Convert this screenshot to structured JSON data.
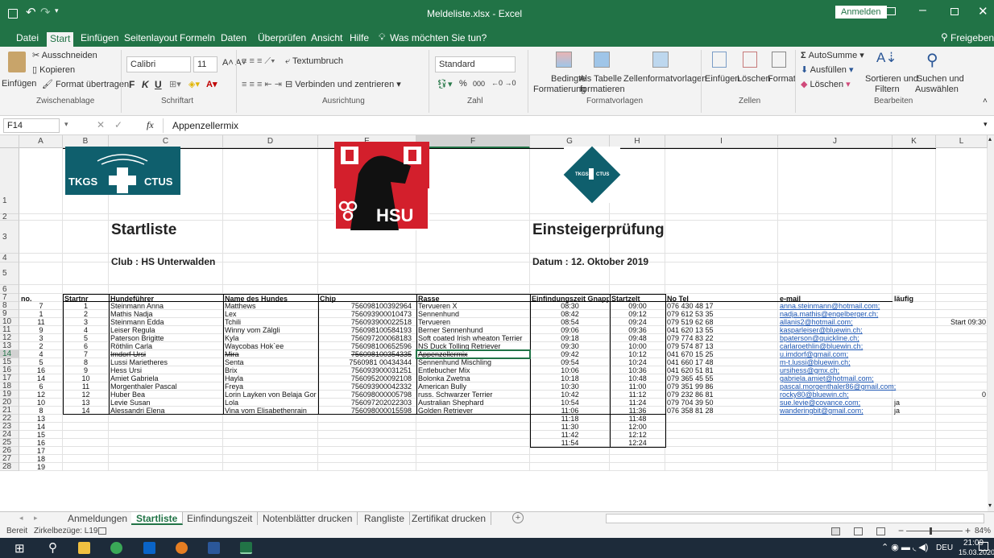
{
  "window": {
    "title": "Meldeliste.xlsx  -  Excel",
    "signin": "Anmelden"
  },
  "tabs": [
    "Datei",
    "Start",
    "Einfügen",
    "Seitenlayout",
    "Formeln",
    "Daten",
    "Überprüfen",
    "Ansicht",
    "Hilfe"
  ],
  "tell_me": "Was möchten Sie tun?",
  "share": "Freigeben",
  "ribbon": {
    "paste": "Einfügen",
    "cut": "Ausschneiden",
    "copy": "Kopieren",
    "format_painter": "Format übertragen",
    "clipboard_group": "Zwischenablage",
    "font_name": "Calibri",
    "font_size": "11",
    "bold": "F",
    "italic": "K",
    "underline": "U",
    "font_group": "Schriftart",
    "wrap": "Textumbruch",
    "merge": "Verbinden und zentrieren",
    "align_group": "Ausrichtung",
    "number_format": "Standard",
    "percent": "%",
    "thousands": "000",
    "number_group": "Zahl",
    "cond_format_1": "Bedingte",
    "cond_format_2": "Formatierung",
    "as_table_1": "Als Tabelle",
    "as_table_2": "formatieren",
    "cell_styles": "Zellenformatvorlagen",
    "styles_group": "Formatvorlagen",
    "insert": "Einfügen",
    "delete": "Löschen",
    "format": "Format",
    "cells_group": "Zellen",
    "autosum": "AutoSumme",
    "fill": "Ausfüllen",
    "clear": "Löschen",
    "sort_1": "Sortieren und",
    "sort_2": "Filtern",
    "find_1": "Suchen und",
    "find_2": "Auswählen",
    "edit_group": "Bearbeiten"
  },
  "formula_bar": {
    "name_box": "F14",
    "fx": "fx",
    "formula": "Appenzellermix"
  },
  "columns": [
    "A",
    "B",
    "C",
    "D",
    "E",
    "F",
    "G",
    "H",
    "I",
    "J",
    "K",
    "L"
  ],
  "sheet": {
    "logo_left": [
      "TKGS",
      "CTUS"
    ],
    "logo_mid": "HSU",
    "logo_right": [
      "TKGS",
      "CTUS"
    ],
    "title_left": "Startliste",
    "title_right": "Einsteigerprüfung",
    "club": "Club :  HS Unterwalden",
    "date": "Datum : 12. Oktober 2019",
    "headers": [
      "no.",
      "Startnr",
      "Hundeführer",
      "Name des Hundes",
      "Chip",
      "Rasse",
      "Einfindungszeit Gnappi",
      "Startzelt",
      "No Tel",
      "e-mail",
      "läufig",
      ""
    ],
    "rows": [
      [
        "7",
        "1",
        "Steinmann Anna",
        "Matthews",
        "756098100392964",
        "Tervueren X",
        "08:30",
        "09:00",
        "076 430 48 17",
        "anna.steinmann@hotmail.com;",
        "",
        ""
      ],
      [
        "1",
        "2",
        "Mathis Nadja",
        "Lex",
        "756093900010473",
        "Sennenhund",
        "08:42",
        "09:12",
        "079 612 53 35",
        "nadja.mathis@engelberger.ch;",
        "",
        ""
      ],
      [
        "11",
        "3",
        "Steinmann Edda",
        "Tchili",
        "756093900022518",
        "Tervueren",
        "08:54",
        "09:24",
        "079 519 62 68",
        "allanis2@hotmail.com;",
        "",
        "Start 09:30"
      ],
      [
        "9",
        "4",
        "Leiser Regula",
        "Winny vom Zälgli",
        "756098100584193",
        "Berner Sennenhund",
        "09:06",
        "09:36",
        "041 620 13 55",
        "kasparleiser@bluewin.ch;",
        "",
        ""
      ],
      [
        "3",
        "5",
        "Paterson Brigitte",
        "Kyla",
        "756097200068183",
        "Soft coated Irish wheaton Terrier",
        "09:18",
        "09:48",
        "079 774 83 22",
        "bpaterson@quickline.ch;",
        "",
        ""
      ],
      [
        "2",
        "6",
        "Röthlin Carla",
        "Waycobas Hok`ee",
        "756098100652596",
        "NS Duck Tolling Retriever",
        "09:30",
        "10:00",
        "079 574 87 13",
        "carlaroethlin@bluewin.ch;",
        "",
        ""
      ],
      [
        "4",
        "7",
        "Imdorf Ursi",
        "Mira",
        "756098100354335",
        "Appenzellermix",
        "09:42",
        "10:12",
        "041 670 15 25",
        "u.imdorf@gmail.com;",
        "",
        ""
      ],
      [
        "5",
        "8",
        "Lussi Marietheres",
        "Senta",
        "7560981 00434344",
        "Sennenhund Mischling",
        "09:54",
        "10:24",
        "041 660 17 48",
        "m-t.lussi@bluewin.ch;",
        "",
        ""
      ],
      [
        "16",
        "9",
        "Hess Ursi",
        "Brix",
        "756093900031251",
        "Entlebucher Mix",
        "10:06",
        "10:36",
        "041 620 51 81",
        "ursihess@gmx.ch;",
        "",
        ""
      ],
      [
        "14",
        "10",
        "Amiet Gabriela",
        "Hayla",
        "756095200092108",
        "Bolonka Zwetna",
        "10:18",
        "10:48",
        "079 365 45 55",
        "gabriela.amiet@hotmail.com;",
        "",
        ""
      ],
      [
        "6",
        "11",
        "Morgenthaler Pascal",
        "Freya",
        "756093900042332",
        "American Bully",
        "10:30",
        "11:00",
        "079 351 99 86",
        "pascal.morgenthaler86@gmail.com;",
        "",
        ""
      ],
      [
        "12",
        "12",
        "Huber Bea",
        "Lorin Layken von Belaja Gora",
        "756098000005798",
        "russ. Schwarzer Terrier",
        "10:42",
        "11:12",
        "079 232 86 81",
        "rocky80@bluewin.ch;",
        "",
        "0"
      ],
      [
        "10",
        "13",
        "Levie Susan",
        "Lola",
        "756097202022303",
        "Australian Shephard",
        "10:54",
        "11:24",
        "079 704 39 50",
        "sue.levie@covance.com;",
        "ja",
        ""
      ],
      [
        "8",
        "14",
        "Alessandri Elena",
        "Vina vom Elisabethenrain",
        "756098000015598",
        "Golden Retriever",
        "11:06",
        "11:36",
        "076 358 81 28",
        "wanderingbit@gmail.com;",
        "ja",
        ""
      ],
      [
        "13",
        "",
        "",
        "",
        "",
        "",
        "11:18",
        "11:48",
        "",
        "",
        "",
        ""
      ],
      [
        "14",
        "",
        "",
        "",
        "",
        "",
        "11:30",
        "12:00",
        "",
        "",
        "",
        ""
      ],
      [
        "15",
        "",
        "",
        "",
        "",
        "",
        "11:42",
        "12:12",
        "",
        "",
        "",
        ""
      ],
      [
        "16",
        "",
        "",
        "",
        "",
        "",
        "11:54",
        "12:24",
        "",
        "",
        "",
        ""
      ],
      [
        "17",
        "",
        "",
        "",
        "",
        "",
        "",
        "",
        "",
        "",
        "",
        ""
      ],
      [
        "18",
        "",
        "",
        "",
        "",
        "",
        "",
        "",
        "",
        "",
        "",
        ""
      ],
      [
        "19",
        "",
        "",
        "",
        "",
        "",
        "",
        "",
        "",
        "",
        "",
        ""
      ]
    ]
  },
  "sheet_tabs": [
    "Anmeldungen",
    "Startliste",
    "Einfindungszeit",
    "Notenblätter drucken",
    "Rangliste",
    "Zertifikat drucken"
  ],
  "status": {
    "ready": "Bereit",
    "circular": "Zirkelbezüge: L19",
    "zoom": "84%"
  },
  "taskbar": {
    "lang": "DEU",
    "time": "21:09",
    "date": "15.03.2020"
  }
}
